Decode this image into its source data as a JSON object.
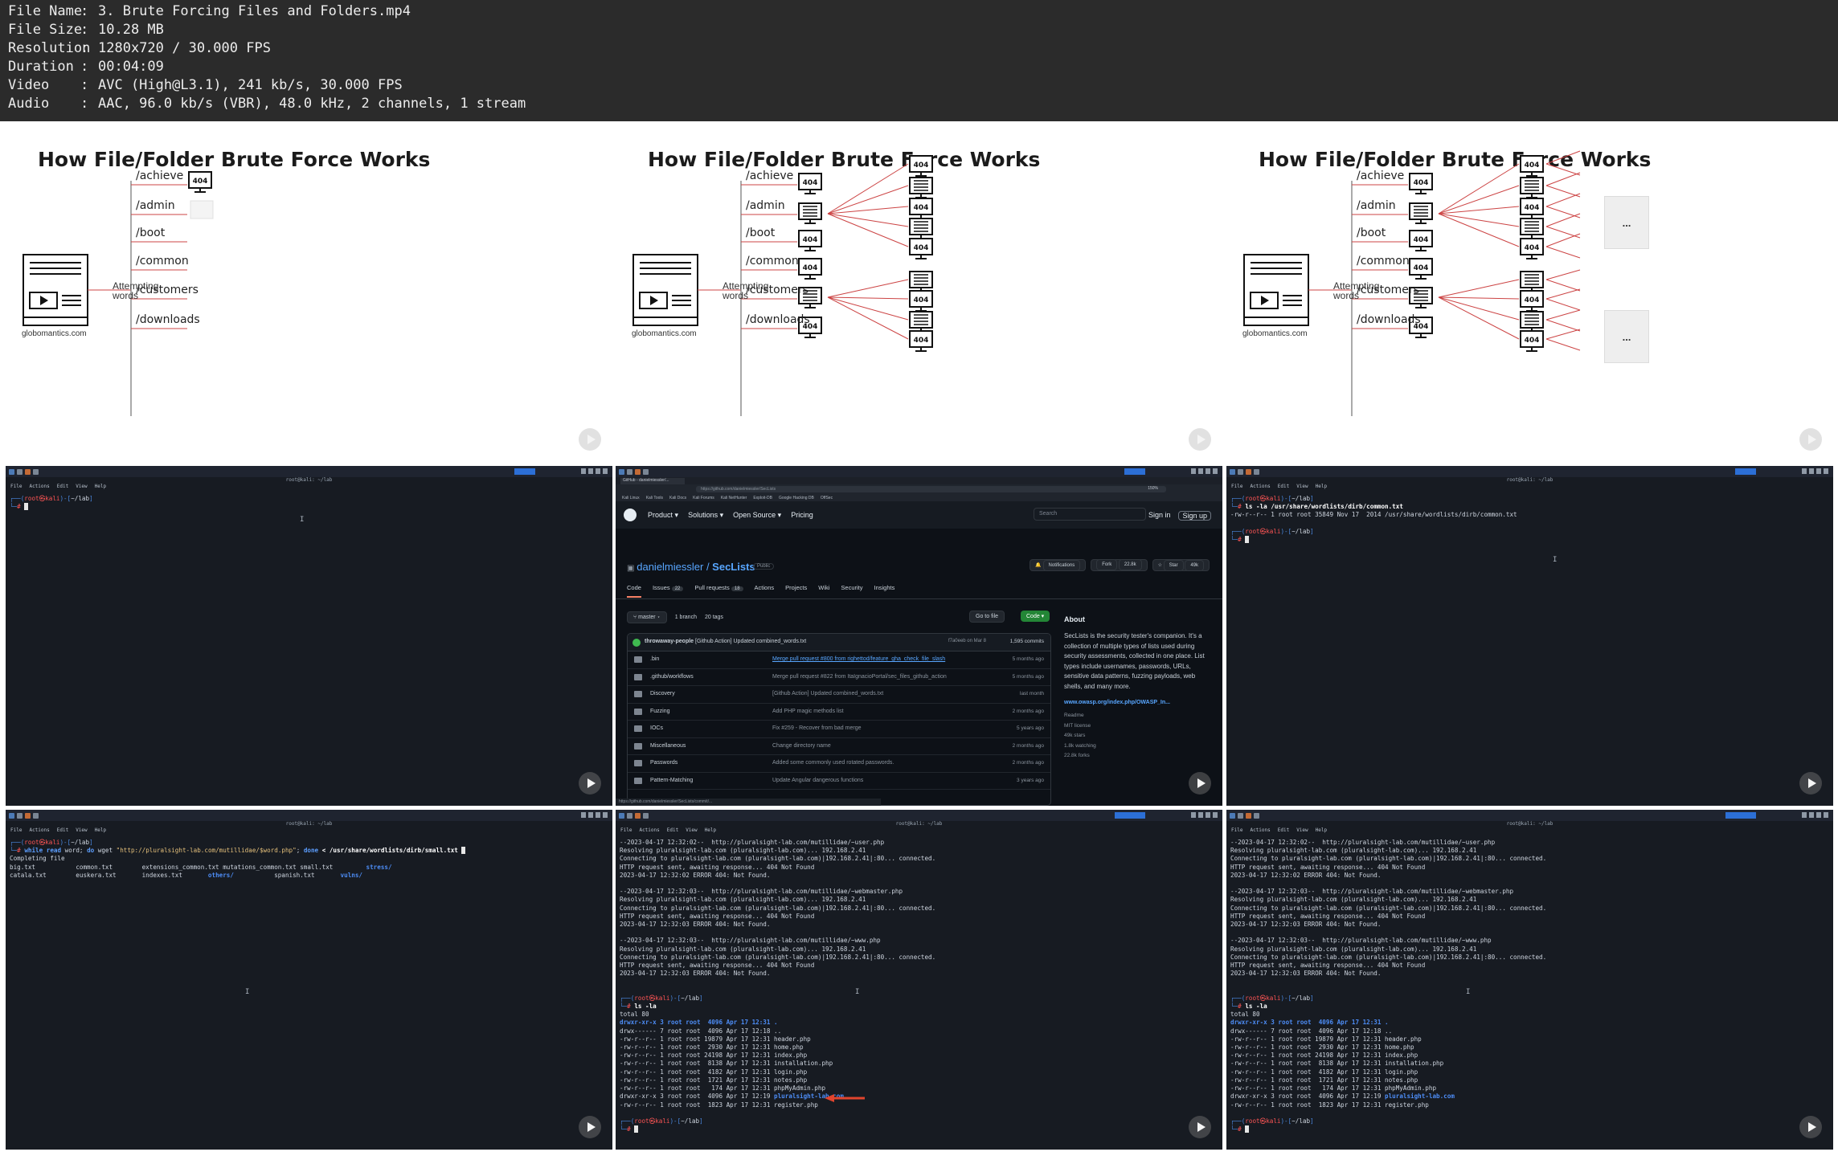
{
  "metadata": [
    {
      "key": "File Name",
      "value": "3. Brute Forcing Files and Folders.mp4"
    },
    {
      "key": "File Size",
      "value": "10.28 MB"
    },
    {
      "key": "Resolution",
      "value": "1280x720 / 30.000 FPS"
    },
    {
      "key": "Duration",
      "value": "00:04:09"
    },
    {
      "key": "Video",
      "value": "AVC (High@L3.1), 241 kb/s, 30.000 FPS"
    },
    {
      "key": "Audio",
      "value": "AAC, 96.0 kb/s (VBR), 48.0 kHz, 2 channels, 1 stream"
    }
  ],
  "slide": {
    "title": "How File/Folder Brute Force Works",
    "attempt": [
      "Attempting",
      "words"
    ],
    "site": "globomantics.com",
    "branches": [
      "/achieve",
      "/admin",
      "/boot",
      "/common",
      "/customers",
      "/downloads"
    ],
    "code": "404",
    "ellipsis": "..."
  },
  "terminal": {
    "window_title": "root@kali: ~/lab",
    "menu": [
      "File",
      "Actions",
      "Edit",
      "View",
      "Help"
    ],
    "prompt_user": "root",
    "prompt_host": "kali",
    "prompt_dir": "~/lab",
    "t2_cmd": "ls -la /usr/share/wordlists/dirb/common.txt",
    "t2_out": "-rw-r--r-- 1 root root 35849 Nov 17  2014 /usr/share/wordlists/dirb/common.txt",
    "t3_cmd_a": "while",
    "t3_cmd_b": "read",
    "t3_cmd_c": " word; ",
    "t3_cmd_d": "do",
    "t3_cmd_e": " wget ",
    "t3_cmd_f": "\"http://pluralsight-lab.com/mutillidae/$word.php\"",
    "t3_cmd_g": "; ",
    "t3_cmd_h": "done",
    "t3_cmd_i": " < /usr/share/wordlists/dirb/small.txt",
    "completing": "Completing file",
    "files_row1": [
      "big.txt",
      "common.txt",
      "extensions_common.txt",
      "mutations_common.txt",
      "small.txt",
      "stress/"
    ],
    "files_row2": [
      "catala.txt",
      "euskera.txt",
      "indexes.txt",
      "others/",
      "spanish.txt",
      "vulns/"
    ],
    "wget_log": [
      "--2023-04-17 12:32:02--  http://pluralsight-lab.com/mutillidae/~user.php",
      "Resolving pluralsight-lab.com (pluralsight-lab.com)... 192.168.2.41",
      "Connecting to pluralsight-lab.com (pluralsight-lab.com)|192.168.2.41|:80... connected.",
      "HTTP request sent, awaiting response... 404 Not Found",
      "2023-04-17 12:32:02 ERROR 404: Not Found.",
      "",
      "--2023-04-17 12:32:03--  http://pluralsight-lab.com/mutillidae/~webmaster.php",
      "Resolving pluralsight-lab.com (pluralsight-lab.com)... 192.168.2.41",
      "Connecting to pluralsight-lab.com (pluralsight-lab.com)|192.168.2.41|:80... connected.",
      "HTTP request sent, awaiting response... 404 Not Found",
      "2023-04-17 12:32:03 ERROR 404: Not Found.",
      "",
      "--2023-04-17 12:32:03--  http://pluralsight-lab.com/mutillidae/~www.php",
      "Resolving pluralsight-lab.com (pluralsight-lab.com)... 192.168.2.41",
      "Connecting to pluralsight-lab.com (pluralsight-lab.com)|192.168.2.41|:80... connected.",
      "HTTP request sent, awaiting response... 404 Not Found",
      "2023-04-17 12:32:03 ERROR 404: Not Found."
    ],
    "ls_cmd": "ls -la",
    "ls_total": "total 80",
    "ls_rows": [
      "drwxr-xr-x 3 root root  4096 Apr 17 12:31 .",
      "drwx------ 7 root root  4096 Apr 17 12:18 ..",
      "-rw-r--r-- 1 root root 19879 Apr 17 12:31 header.php",
      "-rw-r--r-- 1 root root  2930 Apr 17 12:31 home.php",
      "-rw-r--r-- 1 root root 24198 Apr 17 12:31 index.php",
      "-rw-r--r-- 1 root root  8138 Apr 17 12:31 installation.php",
      "-rw-r--r-- 1 root root  4182 Apr 17 12:31 login.php",
      "-rw-r--r-- 1 root root  1721 Apr 17 12:31 notes.php",
      "-rw-r--r-- 1 root root   174 Apr 17 12:31 phpMyAdmin.php"
    ],
    "ls_dir_prefix": "drwxr-xr-x 3 root root  4096 Apr 17 12:19 ",
    "ls_dir_name": "pluralsight-lab.com",
    "ls_last": "-rw-r--r-- 1 root root  1823 Apr 17 12:31 register.php"
  },
  "github": {
    "tab": "GitHub - danielmiessler/...",
    "url": "https://github.com/danielmiessler/SecLists",
    "zoom": "150%",
    "bookmarks": [
      "Kali Linux",
      "Kali Tools",
      "Kali Docs",
      "Kali Forums",
      "Kali NetHunter",
      "Exploit-DB",
      "Google Hacking DB",
      "OffSec"
    ],
    "nav": [
      "Product",
      "Solutions",
      "Open Source",
      "Pricing"
    ],
    "search": "Search",
    "sign_in": "Sign in",
    "sign_up": "Sign up",
    "owner": "danielmiessler",
    "repo": "SecLists",
    "visibility": "Public",
    "notifications": "Notifications",
    "fork": "Fork",
    "fork_count": "22.8k",
    "star": "Star",
    "star_count": "49k",
    "tabs": [
      {
        "label": "Code",
        "count": ""
      },
      {
        "label": "Issues",
        "count": "22"
      },
      {
        "label": "Pull requests",
        "count": "18"
      },
      {
        "label": "Actions",
        "count": ""
      },
      {
        "label": "Projects",
        "count": ""
      },
      {
        "label": "Wiki",
        "count": ""
      },
      {
        "label": "Security",
        "count": ""
      },
      {
        "label": "Insights",
        "count": ""
      }
    ],
    "branch": "master",
    "branches": "1 branch",
    "tags": "20 tags",
    "go_to_file": "Go to file",
    "code_btn": "Code",
    "commit_user": "throwaway-people",
    "commit_msg": "[Github Action] Updated combined_words.txt",
    "commit_sha": "f7a0eeb on Mar 8",
    "commit_count": "1,595 commits",
    "files": [
      {
        "name": ".bin",
        "msg": "Merge pull request #800 from righettod/feature_gha_check_file_slash",
        "time": "5 months ago",
        "link": true
      },
      {
        "name": ".github/workflows",
        "msg": "Merge pull request #822 from ItaIgnacioPortal/sec_files_github_action",
        "time": "5 months ago",
        "link": false
      },
      {
        "name": "Discovery",
        "msg": "[Github Action] Updated combined_words.txt",
        "time": "last month",
        "link": false
      },
      {
        "name": "Fuzzing",
        "msg": "Add PHP magic methods list",
        "time": "2 months ago",
        "link": false
      },
      {
        "name": "IOCs",
        "msg": "Fix #259 - Recover from bad merge",
        "time": "5 years ago",
        "link": false
      },
      {
        "name": "Miscellaneous",
        "msg": "Change directory name",
        "time": "2 months ago",
        "link": false
      },
      {
        "name": "Passwords",
        "msg": "Added some commonly used rotated passwords.",
        "time": "2 months ago",
        "link": false
      },
      {
        "name": "Pattern-Matching",
        "msg": "Update Angular dangerous functions",
        "time": "3 years ago",
        "link": false
      }
    ],
    "about_title": "About",
    "about_text": "SecLists is the security tester's companion. It's a collection of multiple types of lists used during security assessments, collected in one place. List types include usernames, passwords, URLs, sensitive data patterns, fuzzing payloads, web shells, and many more.",
    "about_link": "www.owasp.org/index.php/OWASP_In...",
    "about_meta": [
      "Readme",
      "MIT license",
      "49k stars",
      "1.8k watching",
      "22.8k forks"
    ],
    "status": "https://github.com/danielmiessler/SecLists/commit/..."
  }
}
